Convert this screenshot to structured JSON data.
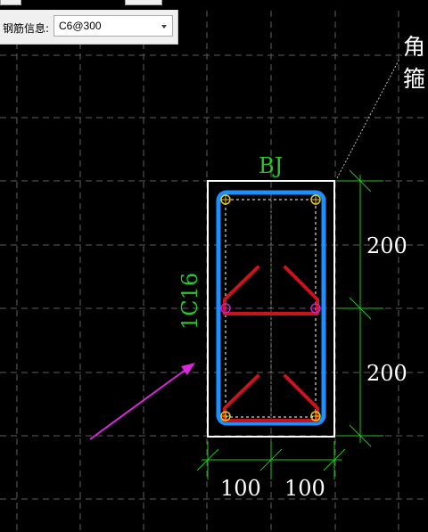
{
  "toolbar": {
    "rebar_info_label": "钢筋信息:",
    "rebar_info_value": "C6@300"
  },
  "drawing": {
    "beam_label": "BJ",
    "bar_label": "1C16",
    "side_note_line1": "角",
    "side_note_line2": "箍",
    "dim_vertical_top": "200",
    "dim_vertical_bottom": "200",
    "dim_horizontal_left": "100",
    "dim_horizontal_right": "100"
  },
  "colors": {
    "background": "#000000",
    "grid": "#6a6a6a",
    "stirrup_outer": "#1e8fff",
    "tie_red": "#c8141e",
    "dimension": "#22c41e",
    "label_green": "#29c729",
    "arrow_magenta": "#d92ad9",
    "corner_bar": "#e6c619",
    "mid_bar": "#c81ec8"
  }
}
